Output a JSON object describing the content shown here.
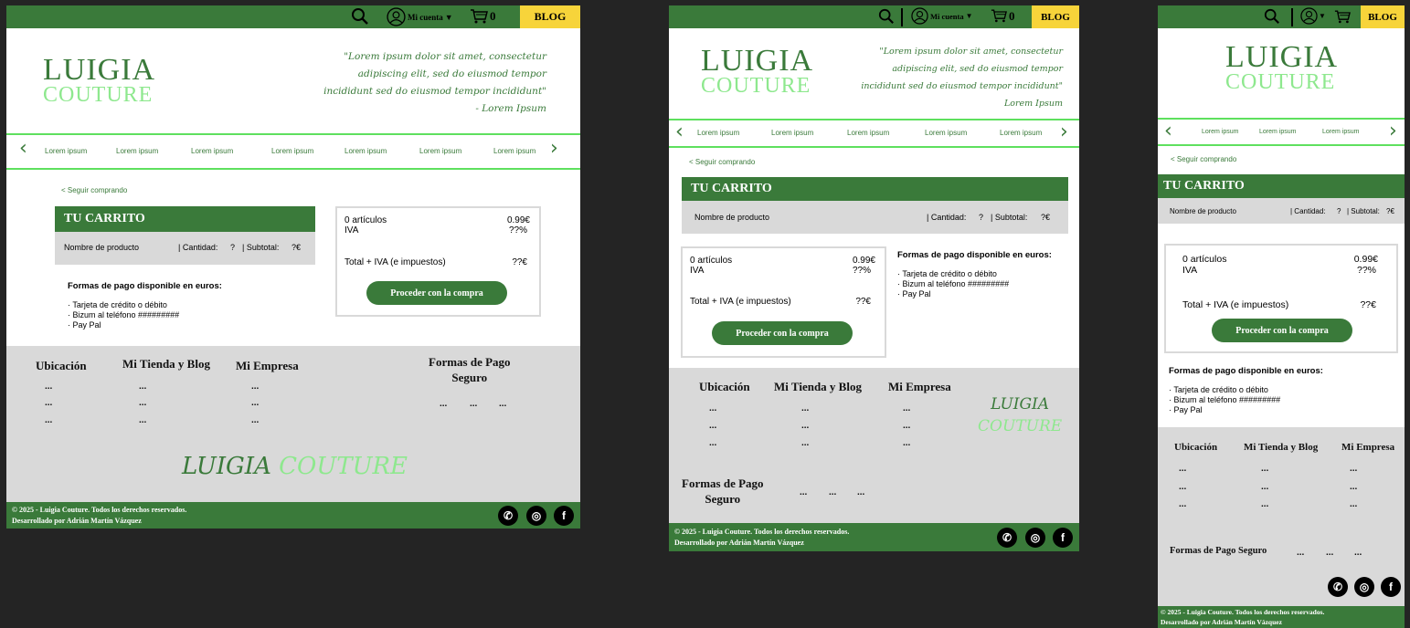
{
  "header": {
    "account_label": "Mi cuenta",
    "cart_count": "0",
    "blog_label": "BLOG"
  },
  "logo": {
    "line1": "LUIGIA",
    "line2": "COUTURE",
    "script_luigia": "LUIGIA",
    "script_couture": "COUTURE"
  },
  "quote": {
    "line1": "\"Lorem ipsum dolor sit amet, consectetur",
    "line2": "adipiscing elit, sed do eiusmod tempor",
    "line3": "incididunt sed do eiusmod tempor incididunt\"",
    "author": "- Lorem Ipsum",
    "author_plain": "Lorem Ipsum"
  },
  "nav": {
    "items": [
      "Lorem ipsum",
      "Lorem ipsum",
      "Lorem ipsum",
      "Lorem ipsum",
      "Lorem ipsum",
      "Lorem ipsum",
      "Lorem ipsum"
    ]
  },
  "cart": {
    "back_link": "< Seguir comprando",
    "title": "TU CARRITO",
    "product_name": "Nombre de producto",
    "quantity_label": "| Cantidad:",
    "quantity_value": "?",
    "subtotal_label": "| Subtotal:",
    "subtotal_value": "?€"
  },
  "summary": {
    "articles_label": "0 artículos",
    "articles_value": "0.99€",
    "iva_label": "IVA",
    "iva_value": "??%",
    "total_label": "Total + IVA (e impuestos)",
    "total_value": "??€",
    "button": "Proceder con la compra"
  },
  "payment": {
    "title": "Formas de pago disponible en euros:",
    "methods": [
      "Tarjeta de crédito o débito",
      "Bizum al teléfono #########",
      "Pay Pal"
    ]
  },
  "footer": {
    "col1": "Ubicación",
    "col2": "Mi Tienda y Blog",
    "col3": "Mi Empresa",
    "col4": "Formas de Pago Seguro",
    "col4_line1": "Formas de Pago",
    "col4_line2": "Seguro",
    "dots": "...",
    "copyright": "© 2025 - Luigia Couture. Todos los derechos reservados.",
    "developer": "Desarrollado por Adrián Martín Vázquez"
  },
  "social": {
    "whatsapp": "whatsapp-icon",
    "instagram": "instagram-icon",
    "facebook": "facebook-icon"
  },
  "colors": {
    "brand_green": "#3a7a3a",
    "light_green": "#8ee88e",
    "accent_yellow": "#f7d43a",
    "footer_gray": "#d9d9d9",
    "background": "#242424"
  }
}
